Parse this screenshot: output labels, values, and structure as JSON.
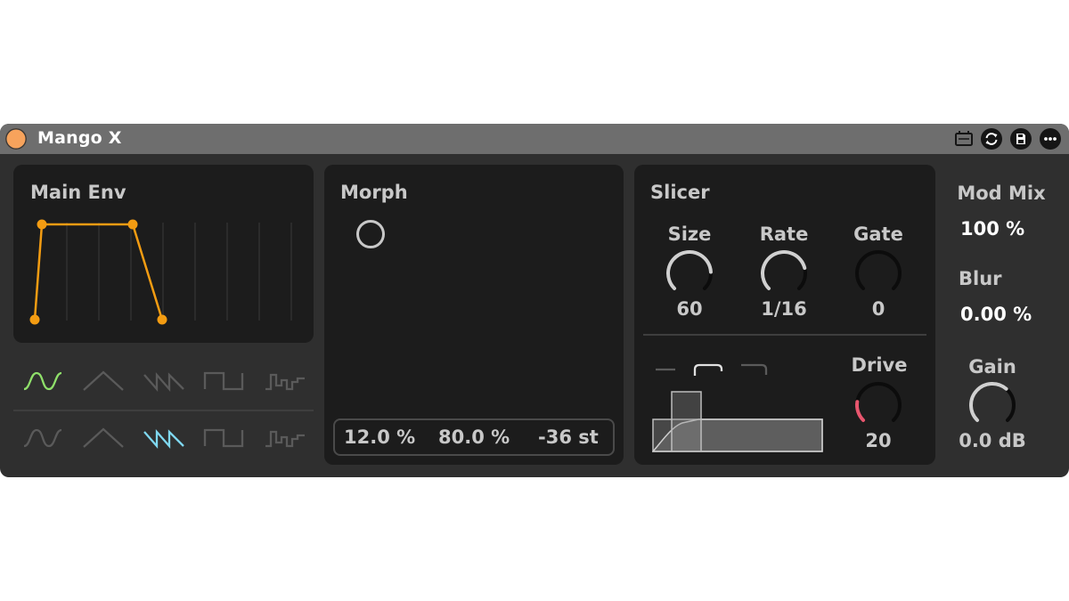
{
  "plugin": {
    "title": "Mango X",
    "power_color": "#f7a35c",
    "titlebar_buttons": [
      "midi-map-icon",
      "refresh-icon",
      "save-icon",
      "more-icon"
    ]
  },
  "envelope": {
    "title": "Main Env",
    "color": "#f39c12",
    "points": [
      [
        0,
        0
      ],
      [
        0.06,
        1
      ],
      [
        0.8,
        1
      ],
      [
        1,
        0
      ]
    ]
  },
  "lfo_shapes": {
    "row1": [
      "sine",
      "triangle",
      "saw",
      "square",
      "random"
    ],
    "row1_selected": "sine",
    "row1_color": "#8fe06a",
    "row2": [
      "sine",
      "triangle",
      "saw",
      "square",
      "random"
    ],
    "row2_selected": "saw",
    "row2_color": "#7fd8f0"
  },
  "morph": {
    "title": "Morph",
    "values": [
      "12.0 %",
      "80.0 %",
      "-36 st"
    ]
  },
  "slicer": {
    "title": "Slicer",
    "size": {
      "label": "Size",
      "value": "60",
      "level": 0.82
    },
    "rate": {
      "label": "Rate",
      "value": "1/16",
      "level": 0.78
    },
    "gate": {
      "label": "Gate",
      "value": "0",
      "level": 0
    },
    "drive": {
      "label": "Drive",
      "value": "20",
      "level": 0.2,
      "color": "#e8566e"
    },
    "curve_modes": [
      "flat",
      "soft",
      "hard"
    ]
  },
  "mix": {
    "mod_mix_label": "Mod Mix",
    "mod_mix_value": "100 %",
    "blur_label": "Blur",
    "blur_value": "0.00 %",
    "gain_label": "Gain",
    "gain_value": "0.0 dB",
    "gain_level": 0.65
  }
}
